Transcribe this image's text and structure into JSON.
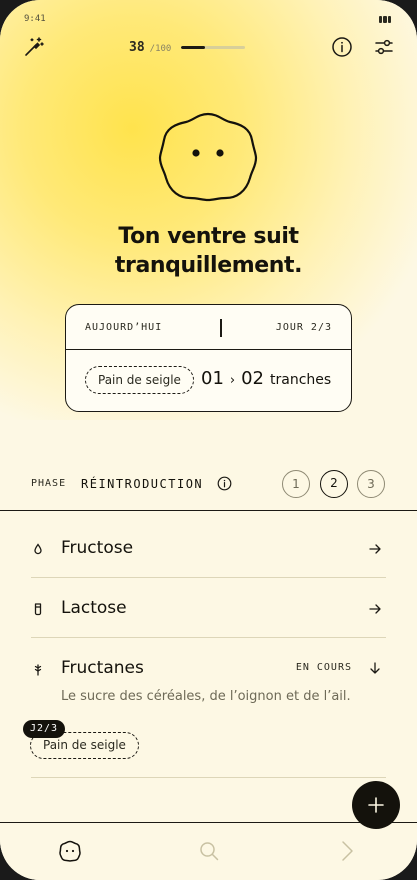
{
  "status_bar": {
    "time": "9:41"
  },
  "header": {
    "score": "38",
    "score_max": "/100",
    "score_progress": 0.38
  },
  "hero": {
    "headline_line1": "Ton ventre suit",
    "headline_line2": "tranquillement."
  },
  "day_card": {
    "today_label": "AUJOURD’HUI",
    "day_label": "JOUR 2/3",
    "food": "Pain de seigle",
    "portion_from": "01",
    "portion_to": "02",
    "portion_unit": "tranches"
  },
  "phase": {
    "label": "PHASE",
    "name": "RÉINTRODUCTION",
    "steps": [
      "1",
      "2",
      "3"
    ],
    "active_step": 2
  },
  "groups": [
    {
      "icon": "droplet-icon",
      "title": "Fructose"
    },
    {
      "icon": "milk-glass-icon",
      "title": "Lactose"
    },
    {
      "icon": "wheat-icon",
      "title": "Fructanes",
      "status": "EN COURS",
      "description": "Le sucre des céréales, de l’oignon et de l’ail.",
      "tag": "J2/3",
      "food": "Pain de seigle"
    }
  ],
  "tabs": [
    "mascot-icon",
    "search-icon",
    "chevron-right-icon"
  ],
  "colors": {
    "accent_yellow": "#ffe34d",
    "background": "#fdf8e4",
    "ink": "#14120c"
  }
}
